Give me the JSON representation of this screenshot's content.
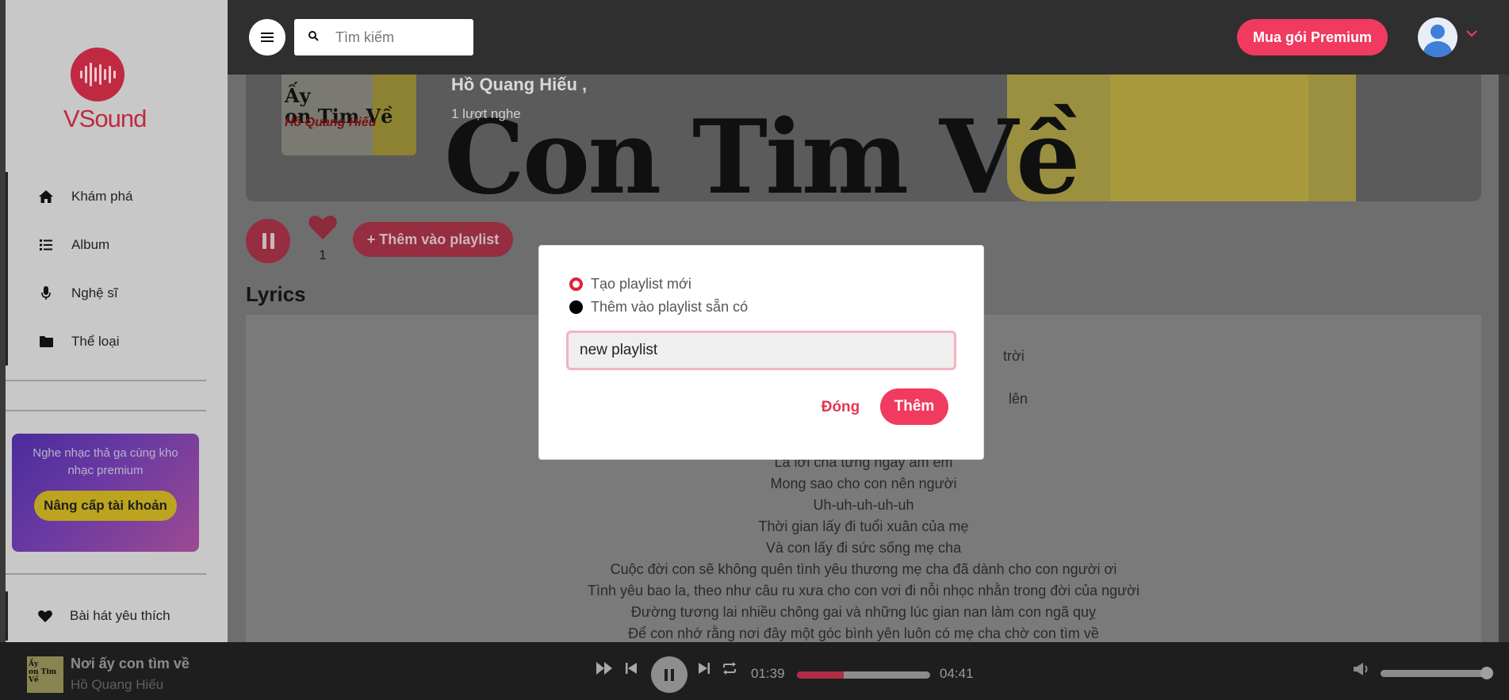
{
  "brand": {
    "name": "VSound"
  },
  "header": {
    "search_placeholder": "Tìm kiếm",
    "premium_label": "Mua gói Premium"
  },
  "sidebar": {
    "items": [
      {
        "label": "Khám phá",
        "icon": "home-icon"
      },
      {
        "label": "Album",
        "icon": "list-icon"
      },
      {
        "label": "Nghệ sĩ",
        "icon": "microphone-icon"
      },
      {
        "label": "Thể loại",
        "icon": "folder-icon"
      }
    ],
    "promo_text": "Nghe nhạc thả ga cùng kho nhạc premium",
    "promo_button": "Nâng cấp tài khoản",
    "favorites_label": "Bài hát yêu thích"
  },
  "song": {
    "banner_title": "Con Tim Về",
    "cover_title": "Ấy\non Tim Về",
    "cover_artist": "Hồ Quang Hiếu",
    "artist": "Hồ Quang Hiếu ,",
    "listens": "1 lượt nghe",
    "likes": "1",
    "add_playlist_label": "+ Thêm vào playlist"
  },
  "lyrics": {
    "title": "Lyrics",
    "fragments": [
      "trời",
      "lên"
    ],
    "lines": [
      "Là lời cha từng ngày ấm êm",
      "Mong sao cho con nên người",
      "Uh-uh-uh-uh-uh",
      "Thời gian lấy đi tuổi xuân của mẹ",
      "Và con lấy đi sức sống mẹ cha",
      "Cuộc đời con sẽ không quên tình yêu thương mẹ cha đã dành cho con người ơi",
      "Tình yêu bao la, theo như câu ru xưa cho con vơi đi nỗi nhọc nhằn trong đời của người",
      "Đường tương lai nhiều chông gai và những lúc gian nan làm con ngã quỵ",
      "Để con nhớ rằng nơi đây một góc bình yên luôn có mẹ cha chờ con tìm về"
    ]
  },
  "modal": {
    "option_new": "Tạo playlist mới",
    "option_existing": "Thêm vào playlist sẵn có",
    "input_value": "new playlist",
    "close_label": "Đóng",
    "add_label": "Thêm"
  },
  "player": {
    "title": "Nơi ấy con tìm về",
    "artist": "Hồ Quang Hiếu",
    "current_time": "01:39",
    "duration": "04:41",
    "progress_fraction": 0.35,
    "volume_fraction": 1.0
  },
  "colors": {
    "accent": "#f03a5f",
    "brand": "#bf2a42"
  }
}
